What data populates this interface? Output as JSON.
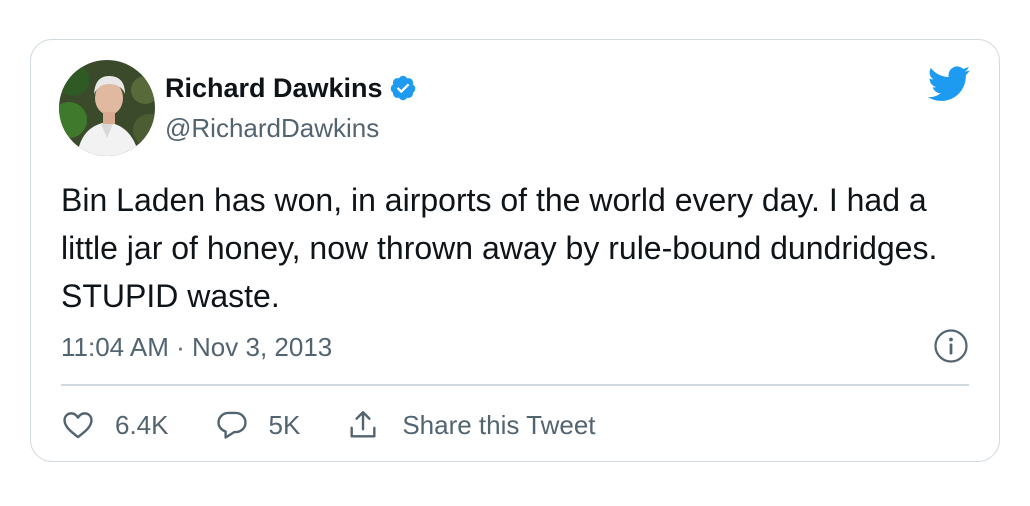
{
  "tweet": {
    "author": {
      "name": "Richard Dawkins",
      "handle": "@RichardDawkins",
      "verified": true
    },
    "text": "Bin Laden has won, in airports of the world every day. I had a little jar of honey, now thrown away by rule-bound dundridges. STUPID waste.",
    "timestamp": "11:04 AM · Nov 3, 2013",
    "actions": {
      "like_count": "6.4K",
      "reply_count": "5K",
      "share_label": "Share this Tweet"
    }
  },
  "icons": {
    "logo": "twitter-bird-icon",
    "verified": "verified-badge-icon",
    "info": "info-icon",
    "like": "heart-icon",
    "reply": "reply-bubble-icon",
    "share": "share-icon"
  },
  "colors": {
    "brand_blue": "#1d9bf0",
    "text_primary": "#0f1419",
    "text_secondary": "#536471",
    "border": "#cfd9de"
  }
}
